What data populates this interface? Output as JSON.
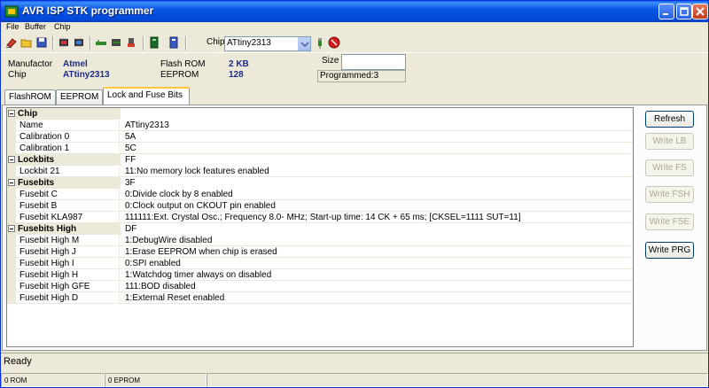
{
  "window": {
    "title": "AVR ISP STK programmer",
    "controls": [
      "minimize-icon",
      "maximize-icon",
      "close-icon"
    ]
  },
  "menu": {
    "items": [
      {
        "label": "File"
      },
      {
        "label": "Buffer"
      },
      {
        "label": "Chip"
      }
    ]
  },
  "toolbar": {
    "icons": [
      "erase-icon",
      "open-icon",
      "save-icon",
      "read-chip-icon",
      "write-chip-icon",
      "connect-icon",
      "device-icon",
      "reset-icon",
      "flash-icon",
      "eeprom-icon",
      "plug-icon",
      "stop-icon"
    ],
    "chip_label": "Chip",
    "chip_selected": "ATtiny2313"
  },
  "info": {
    "manufactor_label": "Manufactor",
    "manufactor_value": "Atmel",
    "chip_label": "Chip",
    "chip_value": "ATtiny2313",
    "flash_label": "Flash ROM",
    "flash_value": "2 KB",
    "eeprom_label": "EEPROM",
    "eeprom_value": "128",
    "size_label": "Size",
    "size_value": "",
    "programmed_text": "Programmed:3"
  },
  "tabs": [
    {
      "label": "FlashROM"
    },
    {
      "label": "EEPROM"
    },
    {
      "label": "Lock and Fuse Bits"
    }
  ],
  "grid": {
    "rows": [
      {
        "type": "cat",
        "name": "Chip",
        "value": ""
      },
      {
        "type": "prop",
        "name": "Name",
        "value": "ATtiny2313"
      },
      {
        "type": "prop",
        "name": "Calibration 0",
        "value": "5A"
      },
      {
        "type": "prop",
        "name": "Calibration 1",
        "value": "5C"
      },
      {
        "type": "cat",
        "name": "Lockbits",
        "value": "FF"
      },
      {
        "type": "prop",
        "name": "Lockbit 21",
        "value": "11:No memory lock features enabled"
      },
      {
        "type": "cat",
        "name": "Fusebits",
        "value": "3F"
      },
      {
        "type": "prop",
        "name": "Fusebit C",
        "value": "0:Divide clock by 8 enabled"
      },
      {
        "type": "prop",
        "name": "Fusebit B",
        "value": "0:Clock output on CKOUT pin enabled"
      },
      {
        "type": "prop",
        "name": "Fusebit KLA987",
        "value": "111111:Ext. Crystal Osc.; Frequency 8.0- MHz; Start-up time: 14 CK + 65 ms; [CKSEL=1111 SUT=11]"
      },
      {
        "type": "cat",
        "name": "Fusebits High",
        "value": "DF"
      },
      {
        "type": "prop",
        "name": "Fusebit High M",
        "value": "1:DebugWire disabled"
      },
      {
        "type": "prop",
        "name": "Fusebit High J",
        "value": "1:Erase EEPROM when chip is erased"
      },
      {
        "type": "prop",
        "name": "Fusebit High I",
        "value": "0:SPI enabled"
      },
      {
        "type": "prop",
        "name": "Fusebit High H",
        "value": "1:Watchdog timer always on disabled"
      },
      {
        "type": "prop",
        "name": "Fusebit High GFE",
        "value": "111:BOD disabled"
      },
      {
        "type": "prop",
        "name": "Fusebit High D",
        "value": "1:External Reset enabled"
      }
    ]
  },
  "buttons": [
    {
      "label": "Refresh",
      "enabled": true
    },
    {
      "label": "Write LB",
      "enabled": false
    },
    {
      "label": "Write FS",
      "enabled": false
    },
    {
      "label": "Write FSH",
      "enabled": false
    },
    {
      "label": "Write FSE",
      "enabled": false
    },
    {
      "label": "Write PRG",
      "enabled": true
    }
  ],
  "status": {
    "text": "Ready",
    "rom": "0 ROM",
    "eeprom": "0 EPROM"
  }
}
